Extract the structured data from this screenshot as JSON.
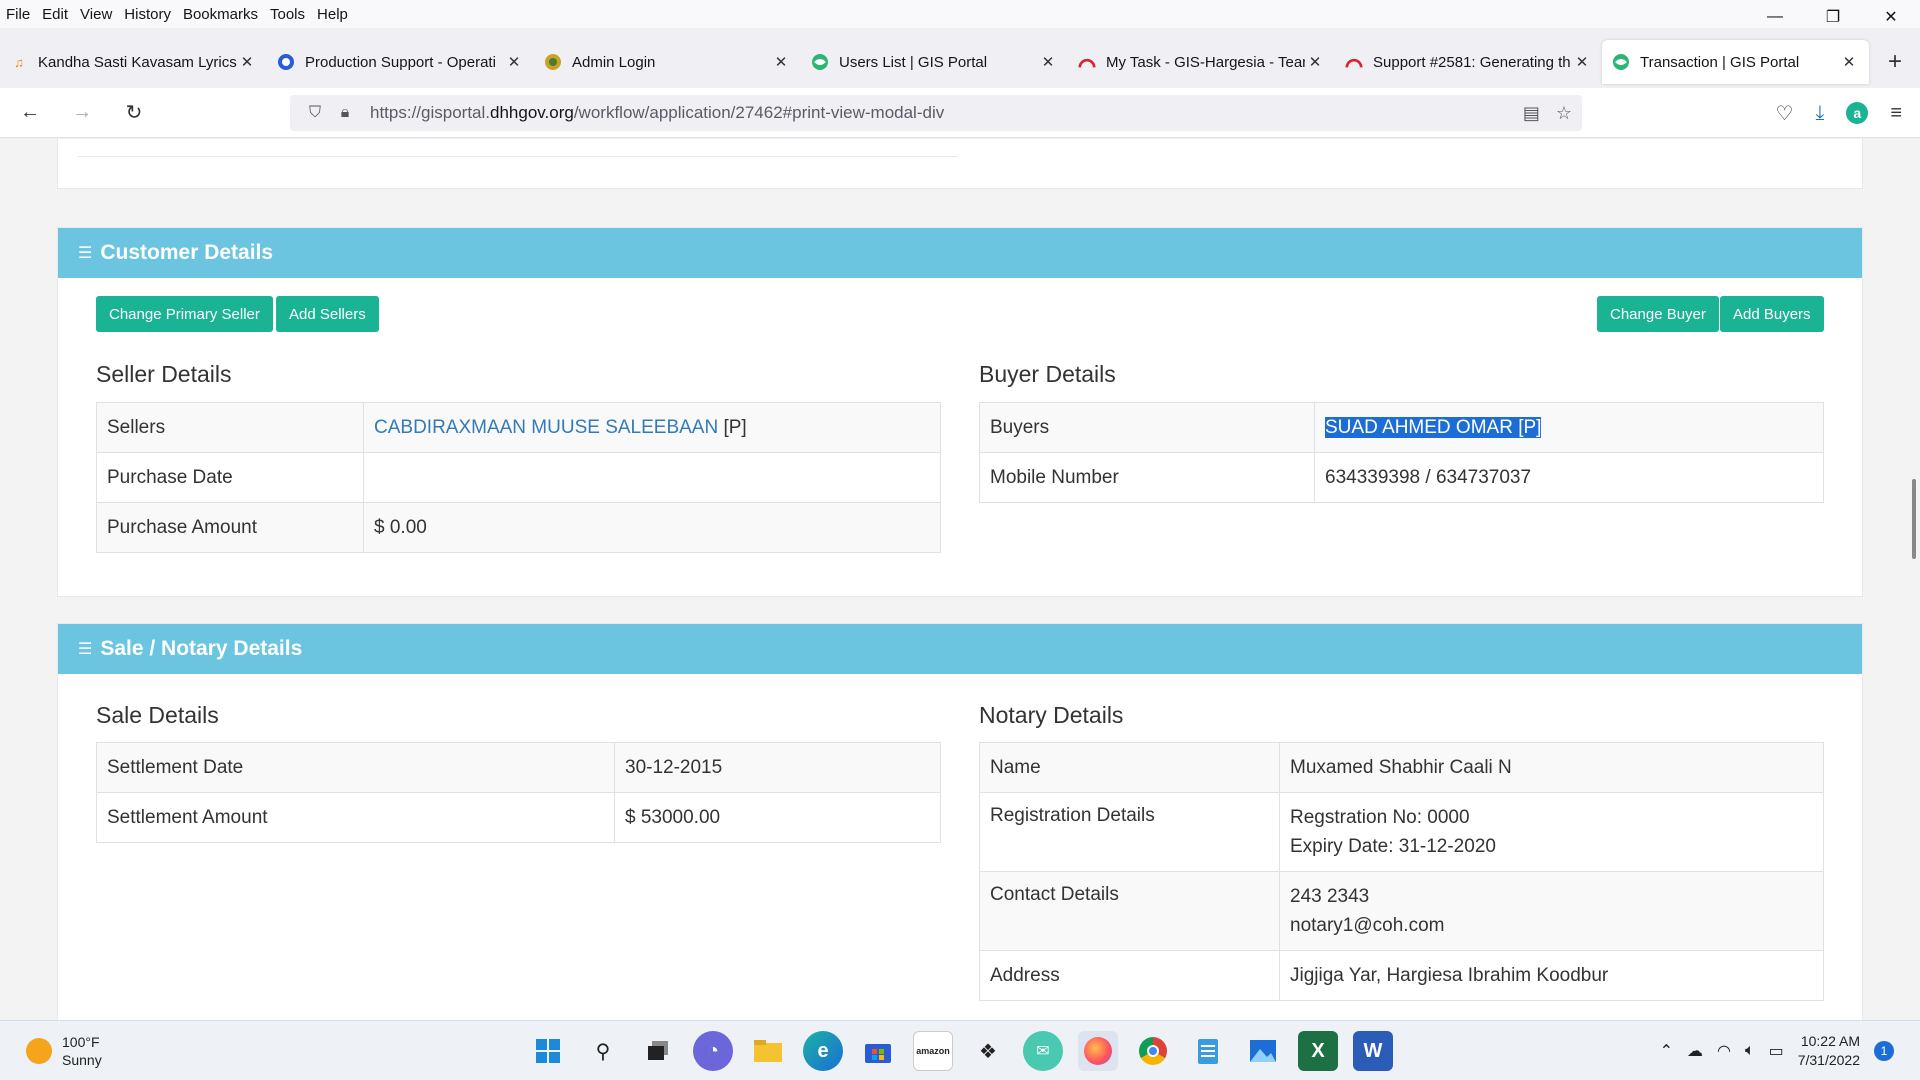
{
  "menubar": {
    "items": [
      "File",
      "Edit",
      "View",
      "History",
      "Bookmarks",
      "Tools",
      "Help"
    ]
  },
  "window_controls": {
    "minimize": "—",
    "restore": "❐",
    "close": "✕"
  },
  "tabs": [
    {
      "title": "Kandha Sasti Kavasam Lyrics i",
      "icon": "music-icon",
      "active": false
    },
    {
      "title": "Production Support - Operati",
      "icon": "power-icon",
      "active": false
    },
    {
      "title": "Admin Login",
      "icon": "seal-icon",
      "active": false
    },
    {
      "title": "Users List | GIS Portal",
      "icon": "globe-icon",
      "active": false
    },
    {
      "title": "My Task - GIS-Hargesia - Tean",
      "icon": "rainbow-icon",
      "active": false
    },
    {
      "title": "Support #2581: Generating th",
      "icon": "rainbow-icon",
      "active": false
    },
    {
      "title": "Transaction | GIS Portal",
      "icon": "globe-icon",
      "active": true
    }
  ],
  "url": {
    "prefix": "https://gisportal.",
    "host": "dhhgov.org",
    "path": "/workflow/application/27462#print-view-modal-div"
  },
  "customer": {
    "header": "Customer Details",
    "buttons": {
      "change_primary_seller": "Change Primary Seller",
      "add_sellers": "Add Sellers",
      "change_buyer": "Change Buyer",
      "add_buyers": "Add Buyers"
    },
    "seller": {
      "title": "Seller Details",
      "sellers_label": "Sellers",
      "sellers_name": "CABDIRAXMAAN MUUSE SALEEBAAN",
      "sellers_suffix": " [P]",
      "purchase_date_label": "Purchase Date",
      "purchase_date_value": "",
      "purchase_amount_label": "Purchase Amount",
      "purchase_amount_value": "$ 0.00"
    },
    "buyer": {
      "title": "Buyer Details",
      "buyers_label": "Buyers",
      "buyers_value": "SUAD AHMED OMAR [P]",
      "mobile_label": "Mobile Number",
      "mobile_value": "634339398 / 634737037"
    }
  },
  "sale": {
    "header": "Sale / Notary Details",
    "sale_details": {
      "title": "Sale Details",
      "settlement_date_label": "Settlement Date",
      "settlement_date_value": "30-12-2015",
      "settlement_amount_label": "Settlement Amount",
      "settlement_amount_value": "$ 53000.00"
    },
    "notary": {
      "title": "Notary Details",
      "name_label": "Name",
      "name_value": "Muxamed Shabhir Caali N",
      "registration_label": "Registration Details",
      "registration_no": "Regstration No: 0000",
      "expiry": "Expiry Date: 31-12-2020",
      "contact_label": "Contact Details",
      "contact_phone": "243 2343",
      "contact_email": "notary1@coh.com",
      "address_label": "Address",
      "address_value": "Jigjiga Yar, Hargiesa Ibrahim Koodbur"
    }
  },
  "taskbar": {
    "temperature": "100°F",
    "condition": "Sunny",
    "time": "10:22 AM",
    "date": "7/31/2022",
    "notifications": "1",
    "apps": [
      "windows-start-icon",
      "search-icon",
      "task-view-icon",
      "chat-icon",
      "file-explorer-icon",
      "edge-icon",
      "store-icon",
      "amazon-icon",
      "dropbox-icon",
      "messaging-icon",
      "firefox-icon",
      "chrome-icon",
      "notepad-icon",
      "photos-icon",
      "excel-icon",
      "word-icon"
    ]
  }
}
